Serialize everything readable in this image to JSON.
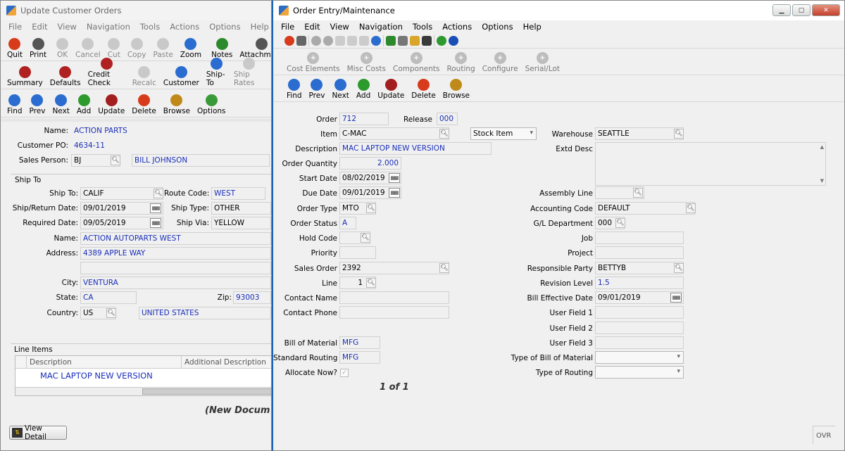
{
  "w1": {
    "title": "Update Customer Orders",
    "menu": [
      "File",
      "Edit",
      "View",
      "Navigation",
      "Tools",
      "Actions",
      "Options",
      "Help"
    ],
    "tb1": [
      {
        "label": "Quit",
        "icon": "power-icon",
        "color": "#d83a1c",
        "dis": false
      },
      {
        "label": "Print",
        "icon": "printer-icon",
        "color": "#555",
        "dis": false
      },
      {
        "label": "OK",
        "icon": "check-icon",
        "color": "#777",
        "dis": true
      },
      {
        "label": "Cancel",
        "icon": "cancel-icon",
        "color": "#777",
        "dis": true
      },
      {
        "label": "Cut",
        "icon": "cut-icon",
        "color": "#777",
        "dis": true
      },
      {
        "label": "Copy",
        "icon": "copy-icon",
        "color": "#777",
        "dis": true
      },
      {
        "label": "Paste",
        "icon": "paste-icon",
        "color": "#777",
        "dis": true
      },
      {
        "label": "Zoom",
        "icon": "zoom-icon",
        "color": "#2a6ccf",
        "dis": false
      },
      {
        "label": "Notes",
        "icon": "notes-icon",
        "color": "#2c8a2c",
        "dis": false
      },
      {
        "label": "Attachment",
        "icon": "attachment-icon",
        "color": "#555",
        "dis": false
      }
    ],
    "tb2": [
      {
        "label": "Summary",
        "icon": "summary-icon",
        "color": "#b02222",
        "dis": false
      },
      {
        "label": "Defaults",
        "icon": "defaults-icon",
        "color": "#b02222",
        "dis": false
      },
      {
        "label": "Credit Check",
        "icon": "credit-check-icon",
        "color": "#b02222",
        "dis": false
      },
      {
        "label": "Recalc",
        "icon": "recalc-icon",
        "color": "#999",
        "dis": true
      },
      {
        "label": "Customer",
        "icon": "customer-icon",
        "color": "#2a6ccf",
        "dis": false
      },
      {
        "label": "Ship-To",
        "icon": "ship-to-icon",
        "color": "#2a6ccf",
        "dis": false
      },
      {
        "label": "Ship Rates",
        "icon": "ship-rates-icon",
        "color": "#999",
        "dis": true
      }
    ],
    "tb3": [
      {
        "label": "Find",
        "icon": "find-icon",
        "color": "#2a6ccf",
        "dis": false
      },
      {
        "label": "Prev",
        "icon": "prev-icon",
        "color": "#2a6ccf",
        "dis": false
      },
      {
        "label": "Next",
        "icon": "next-icon",
        "color": "#2a6ccf",
        "dis": false
      },
      {
        "label": "Add",
        "icon": "add-icon",
        "color": "#2c9a2c",
        "dis": false
      },
      {
        "label": "Update",
        "icon": "update-icon",
        "color": "#a31f1f",
        "dis": false
      },
      {
        "label": "Delete",
        "icon": "delete-icon",
        "color": "#d83a1c",
        "dis": false
      },
      {
        "label": "Browse",
        "icon": "browse-icon",
        "color": "#c08a1a",
        "dis": false
      },
      {
        "label": "Options",
        "icon": "options-icon",
        "color": "#3a9a3a",
        "dis": false
      }
    ],
    "name_label": "Name:",
    "name": "ACTION PARTS",
    "po_label": "Customer PO:",
    "po": "4634-11",
    "sp_label": "Sales Person:",
    "sp": "BJ",
    "sp_name": "BILL JOHNSON",
    "shipto_group": "Ship To",
    "shipto_label": "Ship To:",
    "shipto": "CALIF",
    "route_label": "Route Code:",
    "route": "WEST",
    "shipdate_label": "Ship/Return Date:",
    "shipdate": "09/01/2019",
    "shiptype_label": "Ship Type:",
    "shiptype": "OTHER",
    "reqdate_label": "Required Date:",
    "reqdate": "09/05/2019",
    "shipvia_label": "Ship Via:",
    "shipvia": "YELLOW",
    "sname_label": "Name:",
    "sname": "ACTION AUTOPARTS WEST",
    "addr_label": "Address:",
    "addr": "4389 APPLE WAY",
    "city_label": "City:",
    "city": "VENTURA",
    "state_label": "State:",
    "state": "CA",
    "zip_label": "Zip:",
    "zip": "93003",
    "country_label": "Country:",
    "country": "US",
    "country_name": "UNITED STATES",
    "line_group": "Line Items",
    "col_desc": "Description",
    "col_add": "Additional Description",
    "line1": "MAC LAPTOP  NEW VERSION",
    "newdoc": "(New Docum",
    "viewdetail": "View Detail"
  },
  "w2": {
    "title": "Order Entry/Maintenance",
    "menu": [
      "File",
      "Edit",
      "View",
      "Navigation",
      "Tools",
      "Actions",
      "Options",
      "Help"
    ],
    "tb2": [
      {
        "label": "Cost Elements",
        "icon": "cost-elements-icon"
      },
      {
        "label": "Misc Costs",
        "icon": "misc-costs-icon"
      },
      {
        "label": "Components",
        "icon": "components-icon"
      },
      {
        "label": "Routing",
        "icon": "routing-icon"
      },
      {
        "label": "Configure",
        "icon": "configure-icon"
      },
      {
        "label": "Serial/Lot",
        "icon": "serial-lot-icon"
      }
    ],
    "tb3": [
      {
        "label": "Find",
        "icon": "find-icon",
        "color": "#2a6ccf"
      },
      {
        "label": "Prev",
        "icon": "prev-icon",
        "color": "#2a6ccf"
      },
      {
        "label": "Next",
        "icon": "next-icon",
        "color": "#2a6ccf"
      },
      {
        "label": "Add",
        "icon": "add-icon",
        "color": "#2c9a2c"
      },
      {
        "label": "Update",
        "icon": "update-icon",
        "color": "#a31f1f"
      },
      {
        "label": "Delete",
        "icon": "delete-icon",
        "color": "#d83a1c"
      },
      {
        "label": "Browse",
        "icon": "browse-icon",
        "color": "#c08a1a"
      }
    ],
    "order_label": "Order",
    "order": "712",
    "release_label": "Release",
    "release": "000",
    "item_label": "Item",
    "item": "C-MAC",
    "itemtype": "Stock Item",
    "wh_label": "Warehouse",
    "wh": "SEATTLE",
    "desc_label": "Description",
    "desc": "MAC LAPTOP  NEW VERSION",
    "extd_label": "Extd Desc",
    "qty_label": "Order Quantity",
    "qty": "2.000",
    "start_label": "Start Date",
    "start": "08/02/2019",
    "due_label": "Due Date",
    "due": "09/01/2019",
    "asm_label": "Assembly Line",
    "type_label": "Order Type",
    "type": "MTO",
    "acct_label": "Accounting Code",
    "acct": "DEFAULT",
    "status_label": "Order Status",
    "status": "A",
    "gl_label": "G/L Department",
    "gl": "000",
    "hold_label": "Hold Code",
    "job_label": "Job",
    "prio_label": "Priority",
    "proj_label": "Project",
    "so_label": "Sales Order",
    "so": "2392",
    "resp_label": "Responsible Party",
    "resp": "BETTYB",
    "line_label": "Line",
    "line": "1",
    "rev_label": "Revision Level",
    "rev": "1.5",
    "cname_label": "Contact Name",
    "bed_label": "Bill Effective Date",
    "bed": "09/01/2019",
    "cphone_label": "Contact Phone",
    "uf1_label": "User Field 1",
    "uf2_label": "User Field 2",
    "bom_label": "Bill of Material",
    "bom": "MFG",
    "uf3_label": "User Field 3",
    "sr_label": "Standard Routing",
    "sr": "MFG",
    "tbom_label": "Type of Bill of Material",
    "alloc_label": "Allocate Now?",
    "troute_label": "Type of Routing",
    "pager": "1 of 1",
    "ovr": "OVR"
  }
}
